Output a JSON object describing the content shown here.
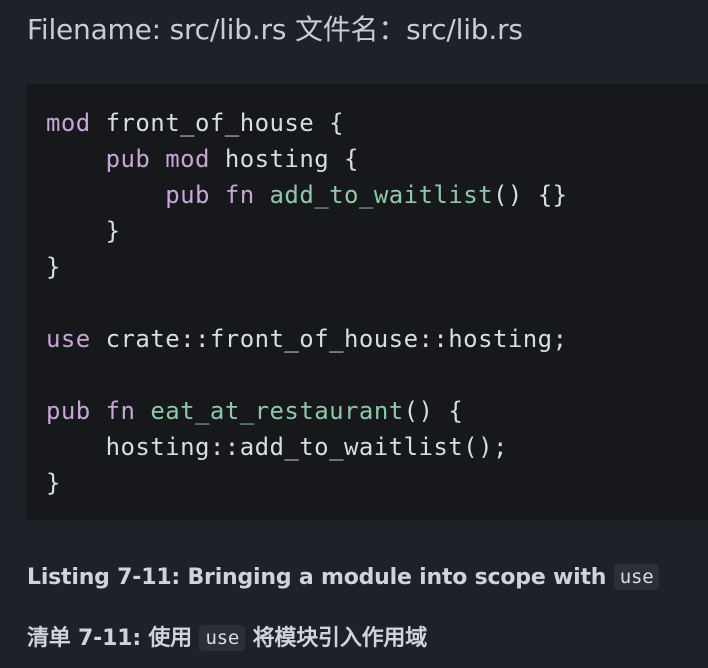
{
  "filename_label": "Filename: src/lib.rs 文件名：src/lib.rs",
  "code": {
    "lines": [
      [
        {
          "t": "mod",
          "c": "kw"
        },
        {
          "t": " front_of_house {",
          "c": "plain"
        }
      ],
      [
        {
          "t": "    ",
          "c": "plain"
        },
        {
          "t": "pub",
          "c": "kw"
        },
        {
          "t": " ",
          "c": "plain"
        },
        {
          "t": "mod",
          "c": "kw"
        },
        {
          "t": " hosting {",
          "c": "plain"
        }
      ],
      [
        {
          "t": "        ",
          "c": "plain"
        },
        {
          "t": "pub",
          "c": "kw"
        },
        {
          "t": " ",
          "c": "plain"
        },
        {
          "t": "fn",
          "c": "kw"
        },
        {
          "t": " ",
          "c": "plain"
        },
        {
          "t": "add_to_waitlist",
          "c": "fn"
        },
        {
          "t": "() {}",
          "c": "plain"
        }
      ],
      [
        {
          "t": "    }",
          "c": "plain"
        }
      ],
      [
        {
          "t": "}",
          "c": "plain"
        }
      ],
      [],
      [
        {
          "t": "use",
          "c": "kw"
        },
        {
          "t": " crate::front_of_house::hosting;",
          "c": "plain"
        }
      ],
      [],
      [
        {
          "t": "pub",
          "c": "kw"
        },
        {
          "t": " ",
          "c": "plain"
        },
        {
          "t": "fn",
          "c": "kw"
        },
        {
          "t": " ",
          "c": "plain"
        },
        {
          "t": "eat_at_restaurant",
          "c": "fn"
        },
        {
          "t": "() {",
          "c": "plain"
        }
      ],
      [
        {
          "t": "    hosting::add_to_waitlist();",
          "c": "plain"
        }
      ],
      [
        {
          "t": "}",
          "c": "plain"
        }
      ]
    ]
  },
  "caption_en": {
    "text": "Listing 7-11: Bringing a module into scope with ",
    "code": "use"
  },
  "caption_zh": {
    "before": "清单 7-11: 使用 ",
    "code": "use",
    "after": " 将模块引入作用域"
  }
}
